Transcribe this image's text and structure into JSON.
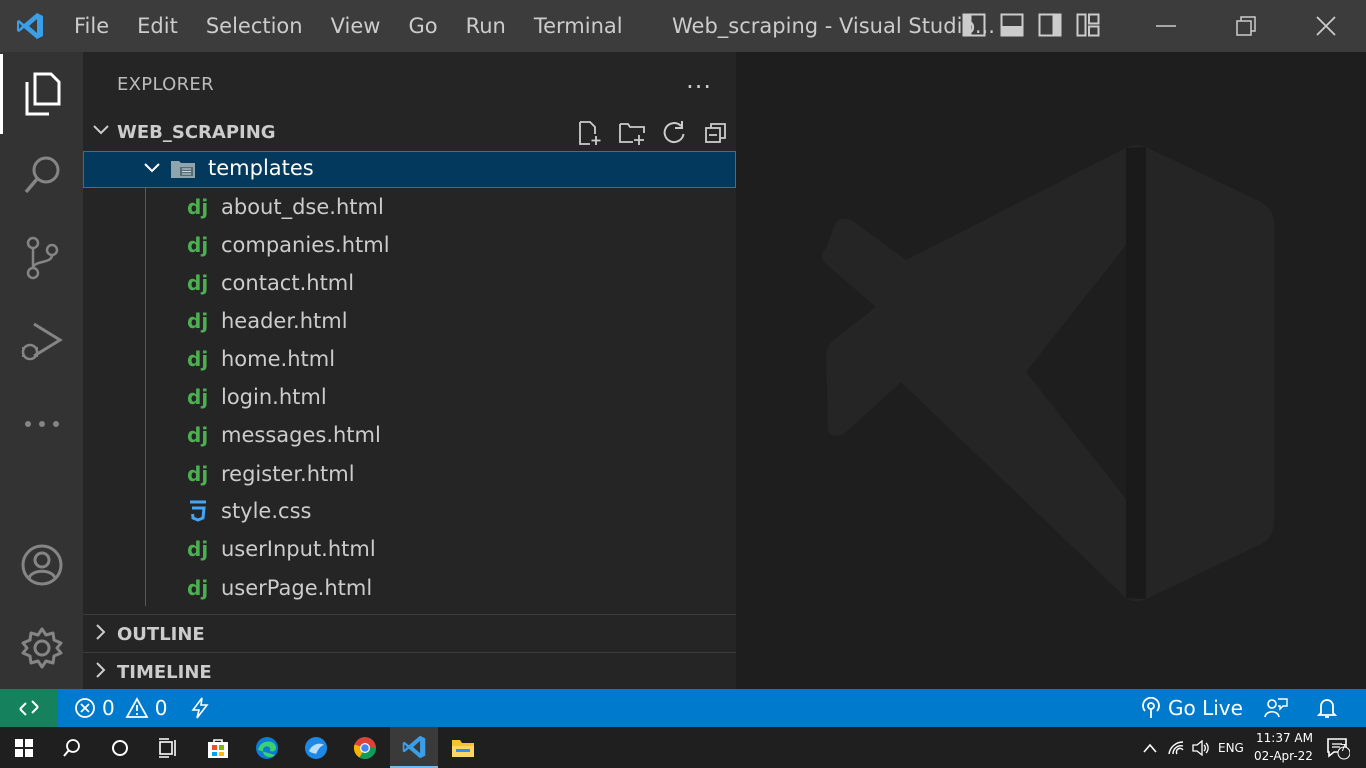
{
  "titlebar": {
    "menu": [
      "File",
      "Edit",
      "Selection",
      "View",
      "Go",
      "Run",
      "Terminal"
    ],
    "window_title": "Web_scraping - Visual Studio..."
  },
  "sidebar": {
    "header": "EXPLORER",
    "more": "...",
    "workspace": "WEB_SCRAPING",
    "folder": "templates",
    "files": [
      {
        "name": "about_dse.html",
        "icon": "django-icon"
      },
      {
        "name": "companies.html",
        "icon": "django-icon"
      },
      {
        "name": "contact.html",
        "icon": "django-icon"
      },
      {
        "name": "header.html",
        "icon": "django-icon"
      },
      {
        "name": "home.html",
        "icon": "django-icon"
      },
      {
        "name": "login.html",
        "icon": "django-icon"
      },
      {
        "name": "messages.html",
        "icon": "django-icon"
      },
      {
        "name": "register.html",
        "icon": "django-icon"
      },
      {
        "name": "style.css",
        "icon": "css-icon"
      },
      {
        "name": "userInput.html",
        "icon": "django-icon"
      },
      {
        "name": "userPage.html",
        "icon": "django-icon"
      }
    ],
    "django_glyph": "dj",
    "outline": "OUTLINE",
    "timeline": "TIMELINE"
  },
  "statusbar": {
    "errors": "0",
    "warnings": "0",
    "go_live": "Go Live"
  },
  "taskbar": {
    "lang": "ENG",
    "time": "11:37 AM",
    "date": "02-Apr-22",
    "notifications": "7"
  },
  "colors": {
    "accent": "#007acc",
    "remote": "#16825d",
    "selection": "#04395e",
    "django": "#4caf50",
    "css": "#42a5f5"
  }
}
